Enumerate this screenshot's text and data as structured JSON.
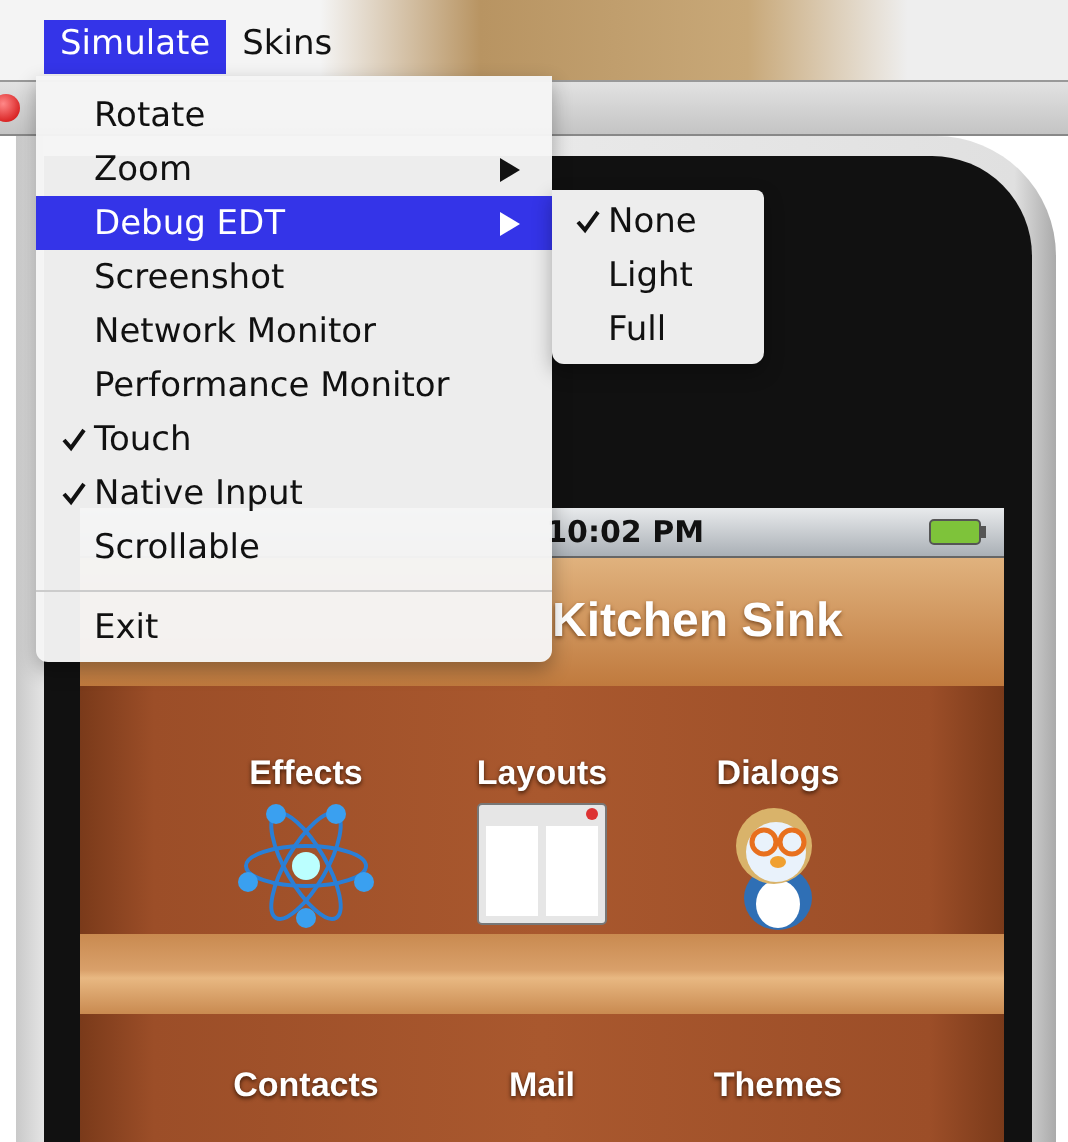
{
  "menubar": [
    {
      "label": "Simulate",
      "selected": true
    },
    {
      "label": "Skins",
      "selected": false
    }
  ],
  "menu": [
    {
      "kind": "item",
      "label": "Rotate",
      "selected": false,
      "checked": false,
      "submenu": false
    },
    {
      "kind": "item",
      "label": "Zoom",
      "selected": false,
      "checked": false,
      "submenu": true
    },
    {
      "kind": "item",
      "label": "Debug EDT",
      "selected": true,
      "checked": false,
      "submenu": true
    },
    {
      "kind": "item",
      "label": "Screenshot",
      "selected": false,
      "checked": false,
      "submenu": false
    },
    {
      "kind": "item",
      "label": "Network Monitor",
      "selected": false,
      "checked": false,
      "submenu": false
    },
    {
      "kind": "item",
      "label": "Performance Monitor",
      "selected": false,
      "checked": false,
      "submenu": false
    },
    {
      "kind": "item",
      "label": "Touch",
      "selected": false,
      "checked": true,
      "submenu": false
    },
    {
      "kind": "item",
      "label": "Native Input",
      "selected": false,
      "checked": true,
      "submenu": false
    },
    {
      "kind": "item",
      "label": "Scrollable",
      "selected": false,
      "checked": false,
      "submenu": false
    },
    {
      "kind": "separator"
    },
    {
      "kind": "item",
      "label": "Exit",
      "selected": false,
      "checked": false,
      "submenu": false
    }
  ],
  "submenu": [
    {
      "label": "None",
      "checked": true
    },
    {
      "label": "Light",
      "checked": false
    },
    {
      "label": "Full",
      "checked": false
    }
  ],
  "phone": {
    "time": "10:02 PM",
    "title": "Kitchen Sink",
    "shelves": [
      [
        {
          "label": "Effects"
        },
        {
          "label": "Layouts"
        },
        {
          "label": "Dialogs"
        }
      ],
      [
        {
          "label": "Contacts"
        },
        {
          "label": "Mail"
        },
        {
          "label": "Themes"
        }
      ]
    ]
  }
}
